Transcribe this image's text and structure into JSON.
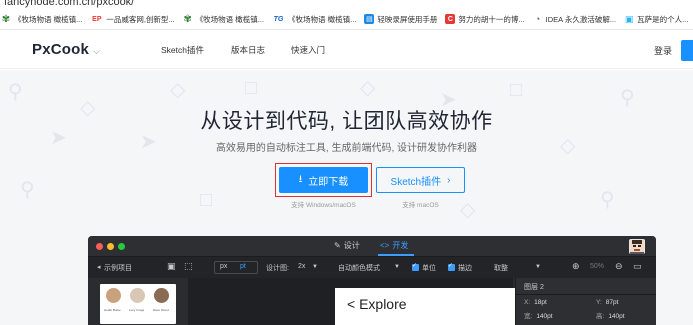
{
  "browser": {
    "url": "fancynode.com.cn/pxcook/",
    "bookmarks": [
      {
        "label": "《牧场物语 橄榄镇...",
        "icon": "flower-icon",
        "color": "#2e7d32"
      },
      {
        "label": "一品威客网,创新型...",
        "icon": "ep-logo-icon",
        "color": "#e53935"
      },
      {
        "label": "《牧场物语 橄榄镇...",
        "icon": "flower-icon",
        "color": "#2e7d32"
      },
      {
        "label": "《牧场物语 橄榄镇...",
        "icon": "tg-logo-icon",
        "color": "#1565c0"
      },
      {
        "label": "轻映录屏使用手册",
        "icon": "doc-icon",
        "color": "#1e88e5"
      },
      {
        "label": "努力的胡十一的博...",
        "icon": "c-logo-icon",
        "color": "#e53935"
      },
      {
        "label": "IDEA 永久激活破解...",
        "icon": "idea-icon",
        "color": "#555555"
      },
      {
        "label": "瓦萨是的个人...",
        "icon": "tv-icon",
        "color": "#29b6f6"
      }
    ]
  },
  "nav": {
    "logo": "PxCook",
    "links": [
      "Sketch插件",
      "版本日志",
      "快速入门"
    ],
    "login": "登录"
  },
  "hero": {
    "title": "从设计到代码, 让团队高效协作",
    "subtitle": "高效易用的自动标注工具, 生成前端代码, 设计研发协作利器",
    "download_label": "立即下载",
    "sketch_label": "Sketch插件",
    "download_caption": "支持 Windows/macOS",
    "sketch_caption": "支持 macOS"
  },
  "app": {
    "tabs": {
      "design": "设计",
      "develop": "开发"
    },
    "toolbar": {
      "project": "示例项目",
      "unit_px": "px",
      "unit_pt": "pt",
      "design_label": "设计图:",
      "design_scale": "2x",
      "color_mode": "自动颜色模式",
      "unit_check": "单位",
      "stroke_check": "描边",
      "value_label": "取整",
      "zoom": "50%"
    },
    "artboard_title": "< Explore",
    "thumb_names": [
      "Heath Burke",
      "Lucy Crags",
      "Dave Wood"
    ],
    "right_panel": {
      "title": "图层 2",
      "x_label": "X:",
      "x_value": "18pt",
      "y_label": "Y:",
      "y_value": "87pt",
      "w_label": "宽:",
      "w_value": "140pt",
      "h_label": "高:",
      "h_value": "140pt"
    }
  },
  "colors": {
    "accent": "#1890ff",
    "highlight": "#e03030",
    "app_dark": "#2b2c30"
  }
}
